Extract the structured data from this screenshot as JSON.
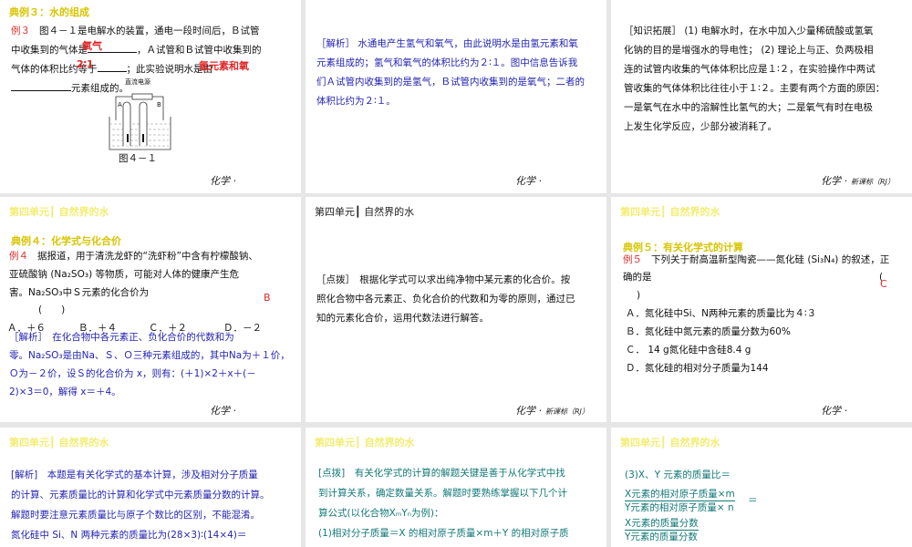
{
  "unit_header": "第四单元┃ 自然界的水",
  "footer": {
    "subject": "化学 ·",
    "edition": "新课标（RJ）"
  },
  "colors": {
    "title_yellow": "#d8c400",
    "answer_red": "#e02828",
    "analysis_blue": "#2424b4",
    "tip_teal": "#147878"
  },
  "slide1": {
    "title": "典例３：水的组成",
    "label": "例３",
    "line1": "图４－１是电解水的装置，通电一段时间后，Ｂ试管",
    "line2a": "中收集到的气体是",
    "line2b": "，Ａ试管和Ｂ试管中收集到的",
    "line3a": "气体的体积比约等于",
    "line3b": "；此实验说明水是由",
    "line4": "元素组成的。",
    "answer1": "氧气",
    "answer2": "2∶1",
    "answer3": "氢元素和氧",
    "diagram_power": "直流电源",
    "diagram_a": "A",
    "diagram_b": "B",
    "caption": "图４－１"
  },
  "slide2": {
    "lines": [
      "［解析］ 水通电产生氢气和氧气，由此说明水是由氢元素和氧",
      "元素组成的；氢气和氧气的体积比约为２∶１。图中信息告诉我",
      "们Ａ试管内收集到的是氢气，Ｂ试管内收集到的是氧气；二者的",
      "体积比约为２∶１。"
    ]
  },
  "slide3": {
    "lines": [
      "［知识拓展］ (1) 电解水时，在水中加入少量稀硫酸或氢氧",
      "化钠的目的是增强水的导电性； (2) 理论上与正、负两极相",
      "连的试管内收集的气体体积比应是１∶２，在实验操作中两试",
      "管收集的气体体积比往往小于１∶２。主要有两个方面的原因：",
      "一是氧气在水中的溶解性比氢气的大；二是氧气有时在电极",
      "上发生化学反应，少部分被消耗了。"
    ]
  },
  "slide4": {
    "title": "典例４：化学式与化合价",
    "label": "例４",
    "lines": [
      "据报道，用于清洗龙虾的“洗虾粉”中含有柠檬酸钠、",
      "亚硫酸钠 (Na₂SO₃) 等物质，可能对人体的健康产生危",
      "害。Na₂SO₃中Ｓ元素的化合价为",
      "(　　)"
    ],
    "answer": "B",
    "options": [
      "Ａ．＋６",
      "Ｂ．＋４",
      "Ｃ．＋２",
      "Ｄ．－２"
    ],
    "analysis": [
      "［解析］　在化合物中各元素正、负化合价的代数和为",
      "零。Na₂SO₃是由Na、Ｓ、Ｏ三种元素组成的，其中Na为＋１价，",
      "Ｏ为－２价，设Ｓ的化合价为 x，则有：(＋1)×2＋x＋(－",
      "2)×3＝0，解得 x＝＋4。"
    ]
  },
  "slide5": {
    "lines": [
      "［点拨］　根据化学式可以求出纯净物中某元素的化合价。按",
      "照化合物中各元素正、负化合价的代数和为零的原则，通过已",
      "知的元素化合价，运用代数法进行解答。"
    ]
  },
  "slide6": {
    "title": "典例５：有关化学式的计算",
    "label": "例５",
    "line1": "下列关于耐高温新型陶瓷——氮化硅 (Si₃N₄) 的叙述，正",
    "line2": "确的是",
    "paren_open": "(",
    "paren_close": ")",
    "answer": "C",
    "options": [
      "Ａ．氮化硅中Si、N两种元素的质量比为４∶３",
      "Ｂ．氮化硅中氮元素的质量分数为60%",
      "Ｃ． 14 g氮化硅中含硅8.4 g",
      "Ｄ．氮化硅的相对分子质量为144"
    ]
  },
  "slide7": {
    "lines": [
      "[解析]　本题是有关化学式的基本计算，涉及相对分子质量",
      "的计算、元素质量比的计算和化学式中元素质量分数的计算。",
      "解题时要注意元素质量比与原子个数比的区别，不能混淆。",
      "氮化硅中 Si、N 两种元素的质量比为(28×3)∶(14×4)＝"
    ]
  },
  "slide8": {
    "lines": [
      "[点拨]　有关化学式的计算的解题关键是善于从化学式中找",
      "到计算关系，确定数量关系。解题时要熟练掌握以下几个计",
      "算公式(以化合物XₘYₙ为例)：",
      "(1)相对分子质量＝X 的相对原子质量×m＋Y 的相对原子质"
    ]
  },
  "slide9": {
    "line1": "(3)X、Y 元素的质量比＝",
    "frac1_num": "X元素的相对原子质量×m",
    "frac1_den": "Y元素的相对原子质量× n",
    "equals": "＝",
    "frac2_num": "X元素的质量分数",
    "frac2_den": "Y元素的质量分数"
  }
}
